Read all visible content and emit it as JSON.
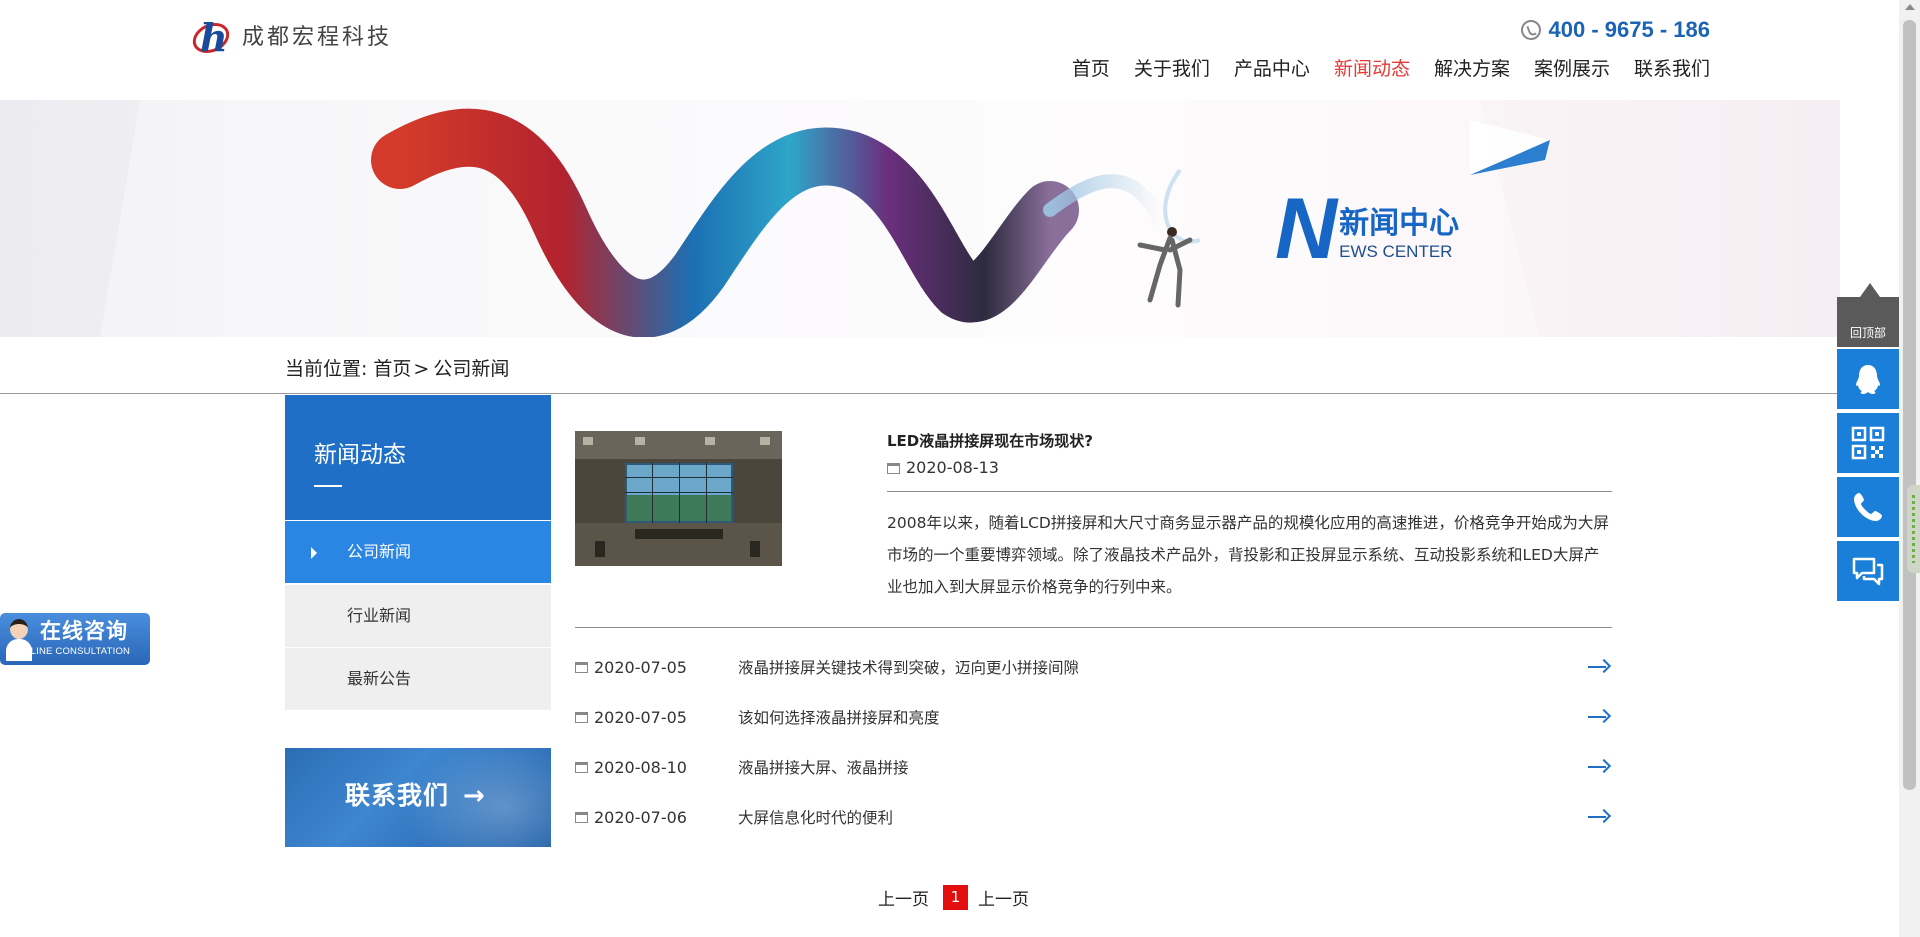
{
  "header": {
    "logo_text": "成都宏程科技",
    "phone": "400 - 9675 - 186",
    "nav": [
      {
        "label": "首页"
      },
      {
        "label": "关于我们"
      },
      {
        "label": "产品中心"
      },
      {
        "label": "新闻动态",
        "active": true
      },
      {
        "label": "解决方案"
      },
      {
        "label": "案例展示"
      },
      {
        "label": "联系我们"
      }
    ]
  },
  "banner": {
    "title_initial": "N",
    "title_cn": "新闻中心",
    "title_en": "EWS CENTER"
  },
  "breadcrumb": {
    "prefix": "当前位置:",
    "home": "首页",
    "separator": ">",
    "current": "公司新闻"
  },
  "sidebar": {
    "heading": "新闻动态",
    "items": [
      {
        "label": "公司新闻",
        "active": true
      },
      {
        "label": "行业新闻"
      },
      {
        "label": "最新公告"
      }
    ],
    "contact_label": "联系我们",
    "contact_arrow": "→"
  },
  "featured": {
    "title": "LED液晶拼接屏现在市场现状?",
    "date": "2020-08-13",
    "excerpt": "2008年以来，随着LCD拼接屏和大尺寸商务显示器产品的规模化应用的高速推进，价格竞争开始成为大屏市场的一个重要博弈领域。除了液晶技术产品外，背投影和正投屏显示系统、互动投影系统和LED大屏产业也加入到大屏显示价格竞争的行列中来。"
  },
  "news_list": [
    {
      "date": "2020-07-05",
      "title": "液晶拼接屏关键技术得到突破，迈向更小拼接间隙"
    },
    {
      "date": "2020-07-05",
      "title": "该如何选择液晶拼接屏和亮度"
    },
    {
      "date": "2020-08-10",
      "title": "液晶拼接大屏、液晶拼接"
    },
    {
      "date": "2020-07-06",
      "title": "大屏信息化时代的便利"
    }
  ],
  "pagination": {
    "prev": "上一页",
    "current": "1",
    "next": "上一页"
  },
  "float_consult": {
    "cn": "在线咨询",
    "en": "ONLINE CONSULTATION"
  },
  "toolbar": {
    "back_to_top": "回顶部",
    "buttons": [
      {
        "icon": "qq-icon"
      },
      {
        "icon": "qr-code-icon"
      },
      {
        "icon": "phone-icon"
      },
      {
        "icon": "chat-icon"
      }
    ]
  },
  "colors": {
    "brand_blue": "#1f6fc7",
    "active_nav": "#e53a36",
    "pager_active": "#e30f0f",
    "toolbar_blue": "#1a7fd9"
  }
}
